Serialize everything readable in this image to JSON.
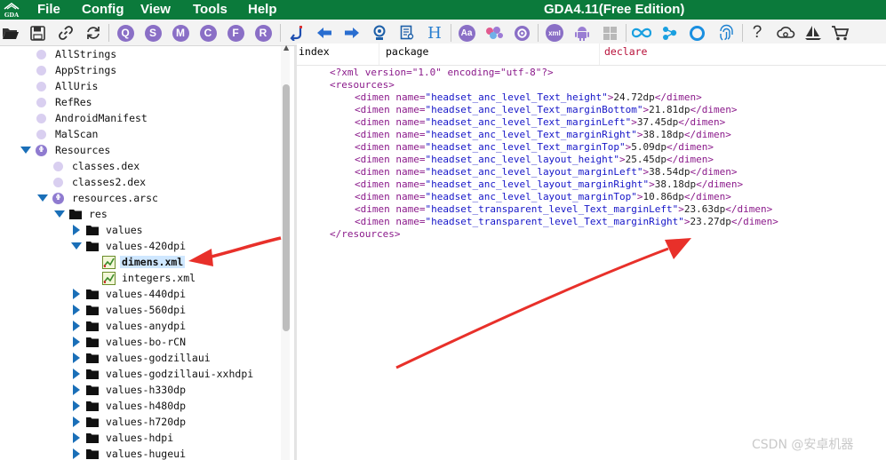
{
  "menubar": {
    "items": [
      "File",
      "Config",
      "View",
      "Tools",
      "Help"
    ],
    "title": "GDA4.11(Free Edition)",
    "logo_text": "GDA"
  },
  "toolbar": {
    "letter_buttons": [
      "Q",
      "S",
      "M",
      "C",
      "F",
      "R"
    ],
    "help_label": "?",
    "xml_label": "xml",
    "aa_label": "Aa",
    "h_label": "H"
  },
  "tree": {
    "items": [
      {
        "label": "AllStrings"
      },
      {
        "label": "AppStrings"
      },
      {
        "label": "AllUris"
      },
      {
        "label": "RefRes"
      },
      {
        "label": "AndroidManifest"
      },
      {
        "label": "MalScan"
      },
      {
        "label": "Resources"
      },
      {
        "label": "classes.dex"
      },
      {
        "label": "classes2.dex"
      },
      {
        "label": "resources.arsc"
      },
      {
        "label": "res"
      },
      {
        "label": "values"
      },
      {
        "label": "values-420dpi"
      },
      {
        "label": "dimens.xml"
      },
      {
        "label": "integers.xml"
      },
      {
        "label": "values-440dpi"
      },
      {
        "label": "values-560dpi"
      },
      {
        "label": "values-anydpi"
      },
      {
        "label": "values-bo-rCN"
      },
      {
        "label": "values-godzillaui"
      },
      {
        "label": "values-godzillaui-xxhdpi"
      },
      {
        "label": "values-h330dp"
      },
      {
        "label": "values-h480dp"
      },
      {
        "label": "values-h720dp"
      },
      {
        "label": "values-hdpi"
      },
      {
        "label": "values-hugeui"
      }
    ],
    "resource_badge": "Φ"
  },
  "header_fields": {
    "index": "index",
    "package": "package",
    "declare": "declare"
  },
  "code": {
    "xml_decl": "<?xml version=\"1.0\" encoding=\"utf-8\"?>",
    "open_tag": "<resources>",
    "close_tag": "</resources>",
    "dimens": [
      {
        "name": "headset_anc_level_Text_height",
        "value": "24.72dp"
      },
      {
        "name": "headset_anc_level_Text_marginBottom",
        "value": "21.81dp"
      },
      {
        "name": "headset_anc_level_Text_marginLeft",
        "value": "37.45dp"
      },
      {
        "name": "headset_anc_level_Text_marginRight",
        "value": "38.18dp"
      },
      {
        "name": "headset_anc_level_Text_marginTop",
        "value": "5.09dp"
      },
      {
        "name": "headset_anc_level_layout_height",
        "value": "25.45dp"
      },
      {
        "name": "headset_anc_level_layout_marginLeft",
        "value": "38.54dp"
      },
      {
        "name": "headset_anc_level_layout_marginRight",
        "value": "38.18dp"
      },
      {
        "name": "headset_anc_level_layout_marginTop",
        "value": "10.86dp"
      },
      {
        "name": "headset_transparent_level_Text_marginLeft",
        "value": "23.63dp"
      },
      {
        "name": "headset_transparent_level_Text_marginRight",
        "value": "23.27dp"
      }
    ]
  },
  "watermark": "CSDN @安卓机器",
  "colors": {
    "menubar_bg": "#0b7a3b",
    "annotation_arrow": "#e8302a",
    "selection": "#cfe7ff",
    "xml_tag": "#8b1a8b",
    "xml_value": "#1515c8"
  }
}
